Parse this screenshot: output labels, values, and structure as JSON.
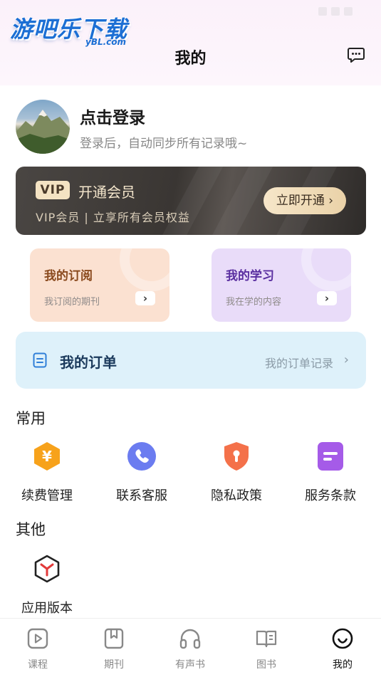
{
  "watermark": {
    "main": "游吧乐下载",
    "sub": "yBL.com"
  },
  "header": {
    "title": "我的"
  },
  "profile": {
    "login_title": "点击登录",
    "login_subtitle": "登录后，自动同步所有记录哦~"
  },
  "vip": {
    "badge": "VIP",
    "title": "开通会员",
    "subtitle": "VIP会员 | 立享所有会员权益",
    "button": "立即开通 ›"
  },
  "cards": [
    {
      "title": "我的订阅",
      "subtitle": "我订阅的期刊",
      "arrow": "›",
      "title_color": "#8a4a1e"
    },
    {
      "title": "我的学习",
      "subtitle": "我在学的内容",
      "arrow": "›",
      "title_color": "#5a2fa0"
    }
  ],
  "orders": {
    "title": "我的订单",
    "link": "我的订单记录",
    "arrow": "›"
  },
  "common": {
    "title": "常用",
    "items": [
      {
        "label": "续费管理",
        "icon": "yuan-hexagon-icon",
        "color": "#f7a21b"
      },
      {
        "label": "联系客服",
        "icon": "phone-icon",
        "color": "#6b7cf0"
      },
      {
        "label": "隐私政策",
        "icon": "privacy-shield-icon",
        "color": "#f4714a"
      },
      {
        "label": "服务条款",
        "icon": "document-icon",
        "color": "#a55be8"
      }
    ]
  },
  "other": {
    "title": "其他",
    "items": [
      {
        "label": "应用版本",
        "icon": "app-version-icon"
      }
    ]
  },
  "tabbar": {
    "items": [
      {
        "label": "课程",
        "icon": "play-icon"
      },
      {
        "label": "期刊",
        "icon": "bookmark-icon"
      },
      {
        "label": "有声书",
        "icon": "headphones-icon"
      },
      {
        "label": "图书",
        "icon": "open-book-icon"
      },
      {
        "label": "我的",
        "icon": "smile-icon"
      }
    ],
    "active_index": 4
  }
}
